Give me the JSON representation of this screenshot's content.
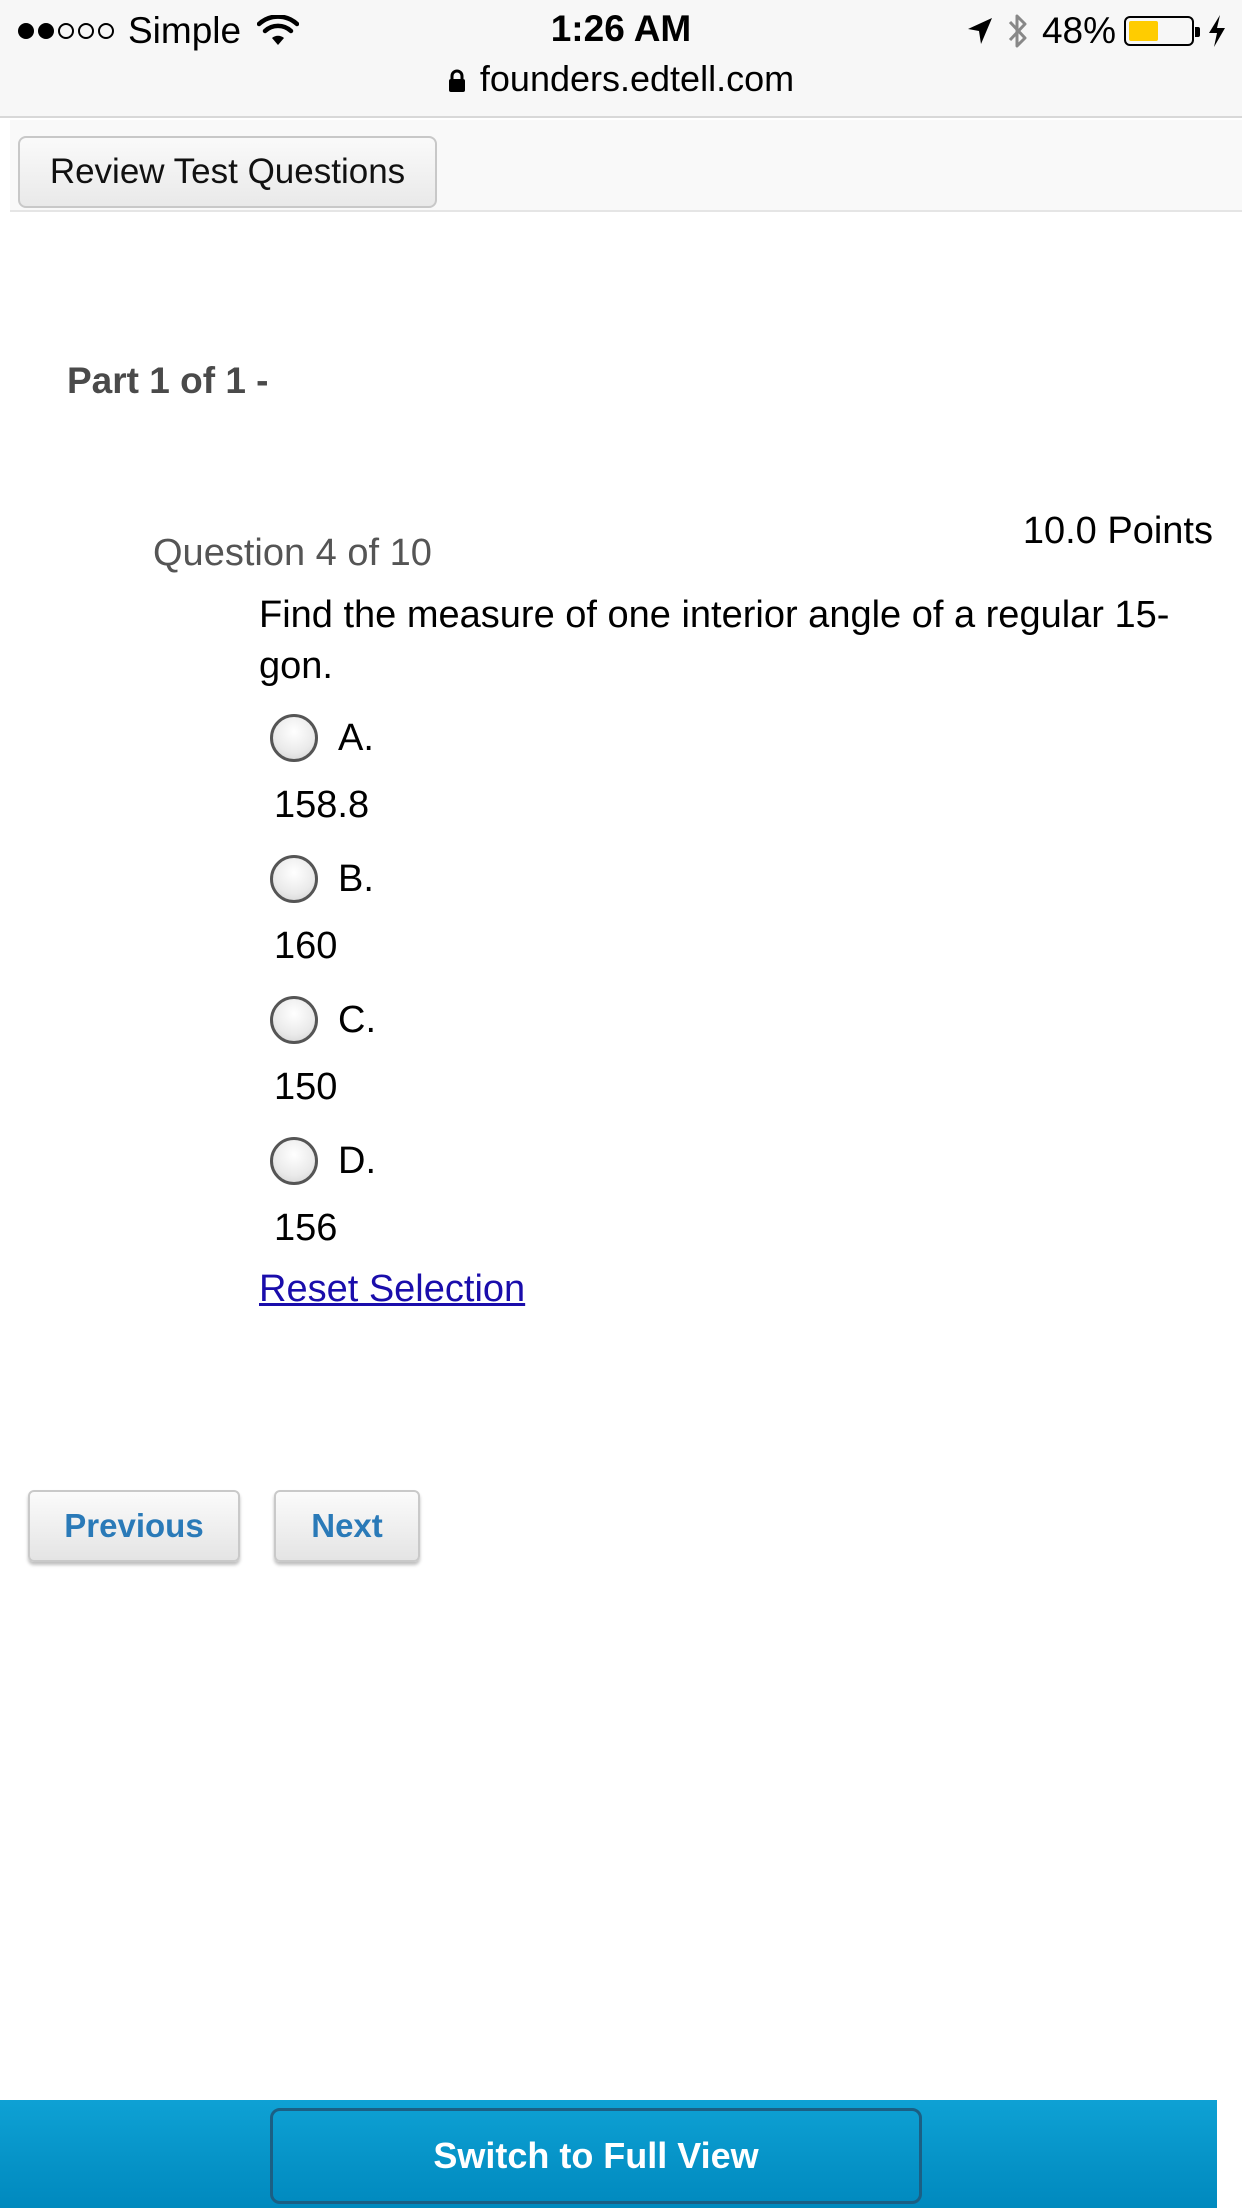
{
  "status_bar": {
    "carrier": "Simple",
    "signal_bars_filled": 2,
    "signal_bars_total": 5,
    "time": "1:26 AM",
    "url": "founders.edtell.com",
    "battery_percent_label": "48%",
    "battery_level": 0.48,
    "battery_color": "#ffcc00",
    "icons": [
      "wifi-icon",
      "lock-icon",
      "location-icon",
      "bluetooth-icon",
      "charging-icon"
    ]
  },
  "toolbar": {
    "review_label": "Review Test Questions"
  },
  "test": {
    "part_title": "Part 1 of 1 -",
    "question_label": "Question 4 of 10",
    "points": "10.0 Points",
    "prompt": "Find the measure of one interior angle of a regular 15-gon.",
    "choices": [
      {
        "letter": "A.",
        "value": "158.8"
      },
      {
        "letter": "B.",
        "value": "160"
      },
      {
        "letter": "C.",
        "value": "150"
      },
      {
        "letter": "D.",
        "value": "156"
      }
    ],
    "reset_label": "Reset Selection"
  },
  "navigation": {
    "previous_label": "Previous",
    "next_label": "Next"
  },
  "footer": {
    "full_view_label": "Switch to Full View"
  },
  "colors": {
    "link": "#1a0dab",
    "nav_button_text": "#2a7ab8",
    "footer_bar": "#0a9bd0"
  }
}
